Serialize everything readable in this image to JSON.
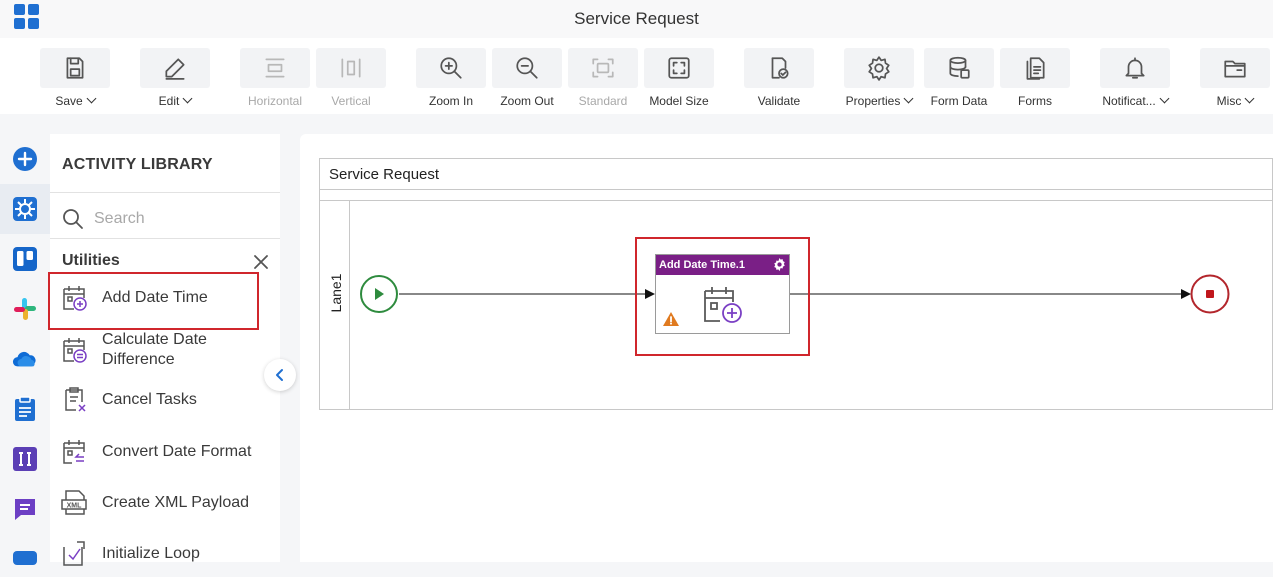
{
  "window": {
    "title": "Service Request"
  },
  "toolbar": {
    "buttons": [
      {
        "label": "Save",
        "icon": "save-icon",
        "dropdown": true,
        "disabled": false
      },
      {
        "label": "Edit",
        "icon": "edit-icon",
        "dropdown": true,
        "disabled": false
      },
      {
        "label": "Horizontal",
        "icon": "horizontal-icon",
        "dropdown": false,
        "disabled": true
      },
      {
        "label": "Vertical",
        "icon": "vertical-icon",
        "dropdown": false,
        "disabled": true
      },
      {
        "label": "Zoom In",
        "icon": "zoom-in-icon",
        "dropdown": false,
        "disabled": false
      },
      {
        "label": "Zoom Out",
        "icon": "zoom-out-icon",
        "dropdown": false,
        "disabled": false
      },
      {
        "label": "Standard",
        "icon": "standard-icon",
        "dropdown": false,
        "disabled": true
      },
      {
        "label": "Model Size",
        "icon": "model-size-icon",
        "dropdown": false,
        "disabled": false
      },
      {
        "label": "Validate",
        "icon": "validate-icon",
        "dropdown": false,
        "disabled": false
      },
      {
        "label": "Properties",
        "icon": "gear-icon",
        "dropdown": true,
        "disabled": false
      },
      {
        "label": "Form Data",
        "icon": "database-icon",
        "dropdown": false,
        "disabled": false
      },
      {
        "label": "Forms",
        "icon": "forms-icon",
        "dropdown": false,
        "disabled": false
      },
      {
        "label": "Notificat...",
        "icon": "bell-icon",
        "dropdown": true,
        "disabled": false
      },
      {
        "label": "Misc",
        "icon": "folder-icon",
        "dropdown": true,
        "disabled": false
      }
    ]
  },
  "library": {
    "title": "ACTIVITY LIBRARY",
    "search_placeholder": "Search",
    "category": "Utilities",
    "items": [
      {
        "label": "Add Date Time",
        "icon": "add-date-time-icon",
        "highlighted": true
      },
      {
        "label": "Calculate Date Difference",
        "icon": "calculate-date-icon"
      },
      {
        "label": "Cancel Tasks",
        "icon": "cancel-tasks-icon"
      },
      {
        "label": "Convert Date Format",
        "icon": "convert-date-icon"
      },
      {
        "label": "Create XML Payload",
        "icon": "xml-payload-icon"
      },
      {
        "label": "Initialize Loop",
        "icon": "initialize-loop-icon"
      }
    ]
  },
  "canvas": {
    "pool_title": "Service Request",
    "lane_label": "Lane1",
    "task_title": "Add Date Time.1",
    "task_warning": true
  },
  "colors": {
    "accent_blue": "#1f6fd1",
    "task_header": "#7a1f86",
    "start_event": "#2e8b3e",
    "end_event": "#b3262c",
    "highlight": "#d0262c"
  }
}
